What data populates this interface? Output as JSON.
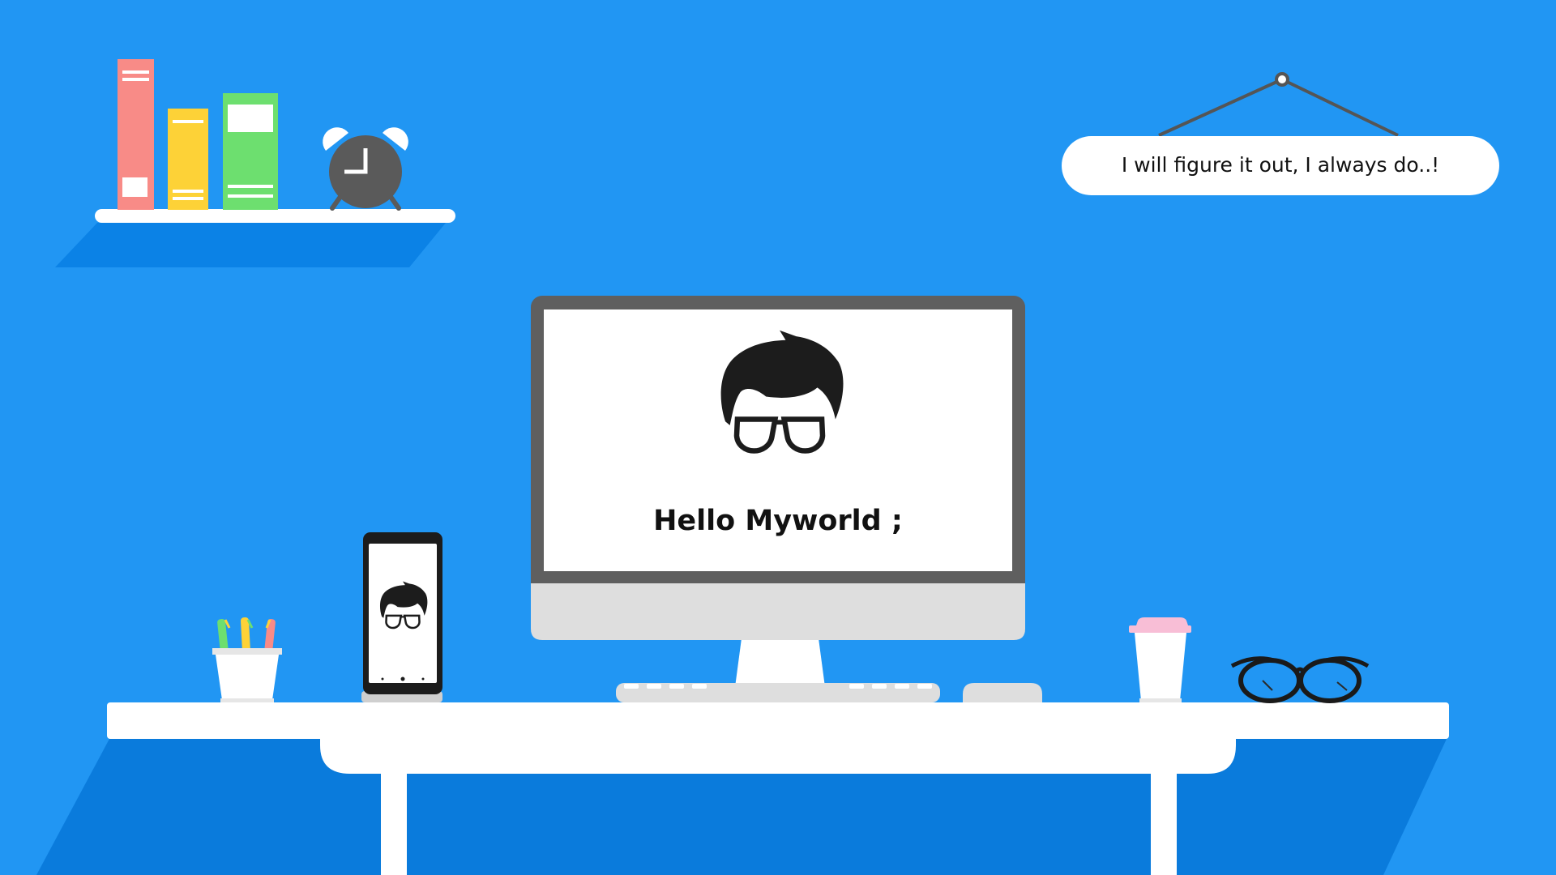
{
  "scene": {
    "sign_text": "I will figure it out, I always do..!",
    "monitor_text": "Hello Myworld ;"
  },
  "colors": {
    "background": "#2196f3",
    "desk": "#ffffff",
    "desk_shadow": "#0a7bdc",
    "monitor_bezel": "#5f5f5f",
    "monitor_chin": "#dedede",
    "book_red": "#f88b87",
    "book_yellow": "#fdd237",
    "book_green": "#6ddf6f",
    "clock": "#5a5a5a",
    "cup_lid": "#f8bed6"
  },
  "icons": [
    "alarm-clock-icon",
    "avatar-glasses-icon",
    "pen-holder-icon",
    "smartphone-icon",
    "coffee-cup-icon",
    "eyeglasses-icon",
    "keyboard-icon",
    "mouse-icon"
  ]
}
